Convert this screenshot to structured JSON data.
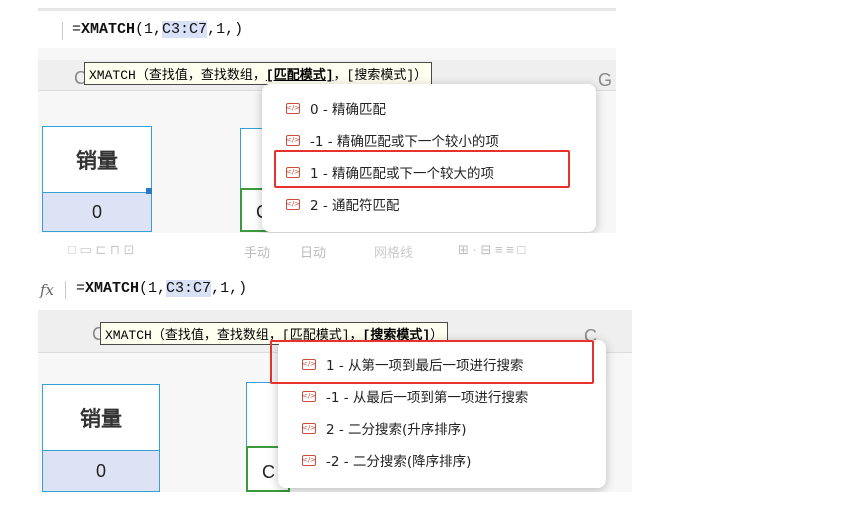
{
  "top": {
    "formula": {
      "prefix": "=",
      "func": "XMATCH",
      "open": "(1,",
      "ref": "C3:C7",
      "rest": ",1,)"
    },
    "tooltip": {
      "func": "XMATCH",
      "open": "（",
      "arg1": "查找值",
      "comma1": "，",
      "arg2": "查找数组",
      "comma2": "，",
      "arg3": "[匹配模式]",
      "comma3": "，",
      "arg4": "[搜索模式]",
      "close": "）"
    },
    "col_letters": {
      "left": "C",
      "mid": "G",
      "right": "G"
    },
    "cell_header": "销量",
    "cell_value": "0",
    "green_cell_text": "C",
    "dropdown": [
      {
        "label": "0 - 精确匹配",
        "icon": "function-tag-icon"
      },
      {
        "label": "-1 - 精确匹配或下一个较小的项",
        "icon": "function-tag-icon"
      },
      {
        "label": "1 - 精确匹配或下一个较大的项",
        "icon": "function-tag-icon"
      },
      {
        "label": "2 - 通配符匹配",
        "icon": "function-tag-icon"
      }
    ],
    "highlighted_index": 2
  },
  "bottom": {
    "toolbar": {
      "text_a": "手动",
      "text_b": "日动",
      "text_c": "网格线"
    },
    "fx_label": "fx",
    "formula": {
      "prefix": "=",
      "func": "XMATCH",
      "open": "(1,",
      "ref": "C3:C7",
      "rest": ",1,)"
    },
    "tooltip": {
      "func": "XMATCH",
      "open": "（",
      "arg1": "查找值",
      "comma1": "，",
      "arg2": "查找数组",
      "comma2": "，",
      "arg3": "[匹配模式]",
      "comma3": "，",
      "arg4": "[搜索模式]",
      "close": "）"
    },
    "col_letters": {
      "left": "C",
      "right": "C"
    },
    "cell_header": "销量",
    "cell_value": "0",
    "green_cell_text": "C",
    "dropdown": [
      {
        "label": "1 - 从第一项到最后一项进行搜索",
        "icon": "function-tag-icon"
      },
      {
        "label": "-1 - 从最后一项到第一项进行搜索",
        "icon": "function-tag-icon"
      },
      {
        "label": "2 - 二分搜索(升序排序)",
        "icon": "function-tag-icon"
      },
      {
        "label": "-2 - 二分搜索(降序排序)",
        "icon": "function-tag-icon"
      }
    ],
    "highlighted_index": 0
  },
  "colors": {
    "highlight": "#e8302c",
    "cell_border": "#34a0d8",
    "selected_cell": "#dde3f5",
    "green_frame": "#3c9a3c"
  }
}
